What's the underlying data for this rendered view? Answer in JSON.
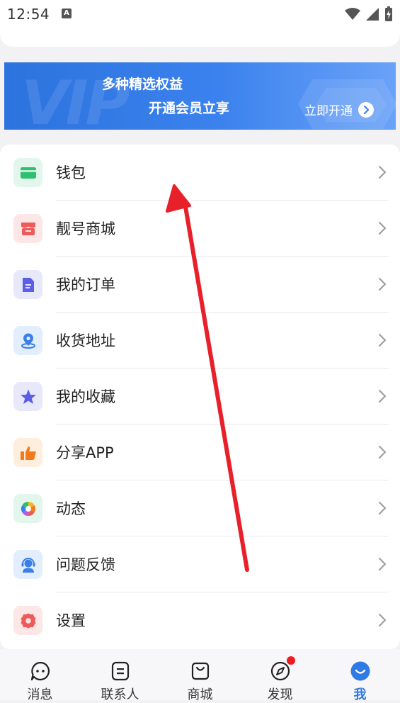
{
  "status_bar": {
    "time": "12:54",
    "notification_glyph": "A"
  },
  "banner": {
    "line1": "多种精选权益",
    "line2": "开通会员立享",
    "cta": "立即开通",
    "deco_text": "VIP"
  },
  "menu": {
    "items": [
      {
        "label": "钱包",
        "icon": "wallet-icon",
        "color": "#2fbf71"
      },
      {
        "label": "靓号商城",
        "icon": "shop-icon",
        "color": "#ee5a5a"
      },
      {
        "label": "我的订单",
        "icon": "order-document-icon",
        "color": "#5a5ee8"
      },
      {
        "label": "收货地址",
        "icon": "location-pin-icon",
        "color": "#3a7ee6"
      },
      {
        "label": "我的收藏",
        "icon": "star-icon",
        "color": "#5a5ee8"
      },
      {
        "label": "分享APP",
        "icon": "thumbs-up-icon",
        "color": "#f07b1c"
      },
      {
        "label": "动态",
        "icon": "aperture-icon",
        "color": "#2fbf71"
      },
      {
        "label": "问题反馈",
        "icon": "support-agent-icon",
        "color": "#3a7ee6"
      },
      {
        "label": "设置",
        "icon": "gear-icon",
        "color": "#ee5a5a"
      }
    ]
  },
  "tabbar": {
    "tabs": [
      {
        "label": "消息",
        "icon": "chat-bubble-icon"
      },
      {
        "label": "联系人",
        "icon": "contacts-icon"
      },
      {
        "label": "商城",
        "icon": "shopping-bag-icon"
      },
      {
        "label": "发现",
        "icon": "compass-icon",
        "badge": true
      },
      {
        "label": "我",
        "icon": "smile-profile-icon",
        "active": true
      }
    ]
  },
  "colors": {
    "accent": "#2e7be6",
    "annotation_arrow": "#e8202a",
    "badge": "#ee1c1c"
  }
}
